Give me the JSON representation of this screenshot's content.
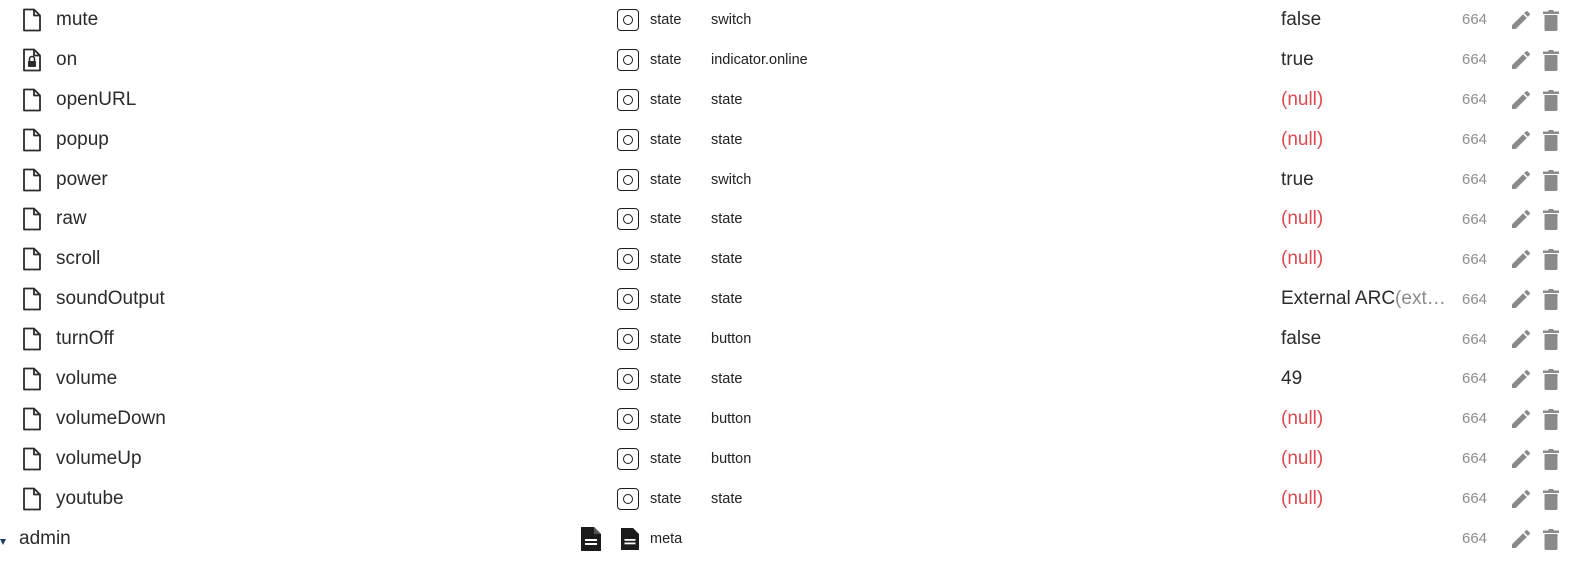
{
  "colors": {
    "null_value": "#e0484f",
    "acl_text": "#8c8c8c",
    "action_icon": "#8a8a8a"
  },
  "rows": [
    {
      "name": "mute",
      "type": "state",
      "role": "switch",
      "value": "false",
      "acl": "664",
      "locked": false,
      "is_null": false
    },
    {
      "name": "on",
      "type": "state",
      "role": "indicator.online",
      "value": "true",
      "acl": "664",
      "locked": true,
      "is_null": false
    },
    {
      "name": "openURL",
      "type": "state",
      "role": "state",
      "value": "(null)",
      "acl": "664",
      "locked": false,
      "is_null": true
    },
    {
      "name": "popup",
      "type": "state",
      "role": "state",
      "value": "(null)",
      "acl": "664",
      "locked": false,
      "is_null": true
    },
    {
      "name": "power",
      "type": "state",
      "role": "switch",
      "value": "true",
      "acl": "664",
      "locked": false,
      "is_null": false
    },
    {
      "name": "raw",
      "type": "state",
      "role": "state",
      "value": "(null)",
      "acl": "664",
      "locked": false,
      "is_null": true
    },
    {
      "name": "scroll",
      "type": "state",
      "role": "state",
      "value": "(null)",
      "acl": "664",
      "locked": false,
      "is_null": true
    },
    {
      "name": "soundOutput",
      "type": "state",
      "role": "state",
      "value": "External ARC",
      "value_suffix": "(ext…",
      "acl": "664",
      "locked": false,
      "is_null": false
    },
    {
      "name": "turnOff",
      "type": "state",
      "role": "button",
      "value": "false",
      "acl": "664",
      "locked": false,
      "is_null": false
    },
    {
      "name": "volume",
      "type": "state",
      "role": "state",
      "value": "49",
      "acl": "664",
      "locked": false,
      "is_null": false
    },
    {
      "name": "volumeDown",
      "type": "state",
      "role": "button",
      "value": "(null)",
      "acl": "664",
      "locked": false,
      "is_null": true
    },
    {
      "name": "volumeUp",
      "type": "state",
      "role": "button",
      "value": "(null)",
      "acl": "664",
      "locked": false,
      "is_null": true
    },
    {
      "name": "youtube",
      "type": "state",
      "role": "state",
      "value": "(null)",
      "acl": "664",
      "locked": false,
      "is_null": true
    }
  ],
  "folder": {
    "name": "admin",
    "type": "meta",
    "acl": "664"
  },
  "icons": {
    "file": "file-icon",
    "locked_file": "locked-file-icon",
    "state_type": "state-type-icon",
    "edit": "pencil-icon",
    "delete": "trash-icon",
    "expand": "caret-down-icon",
    "document": "document-icon"
  }
}
